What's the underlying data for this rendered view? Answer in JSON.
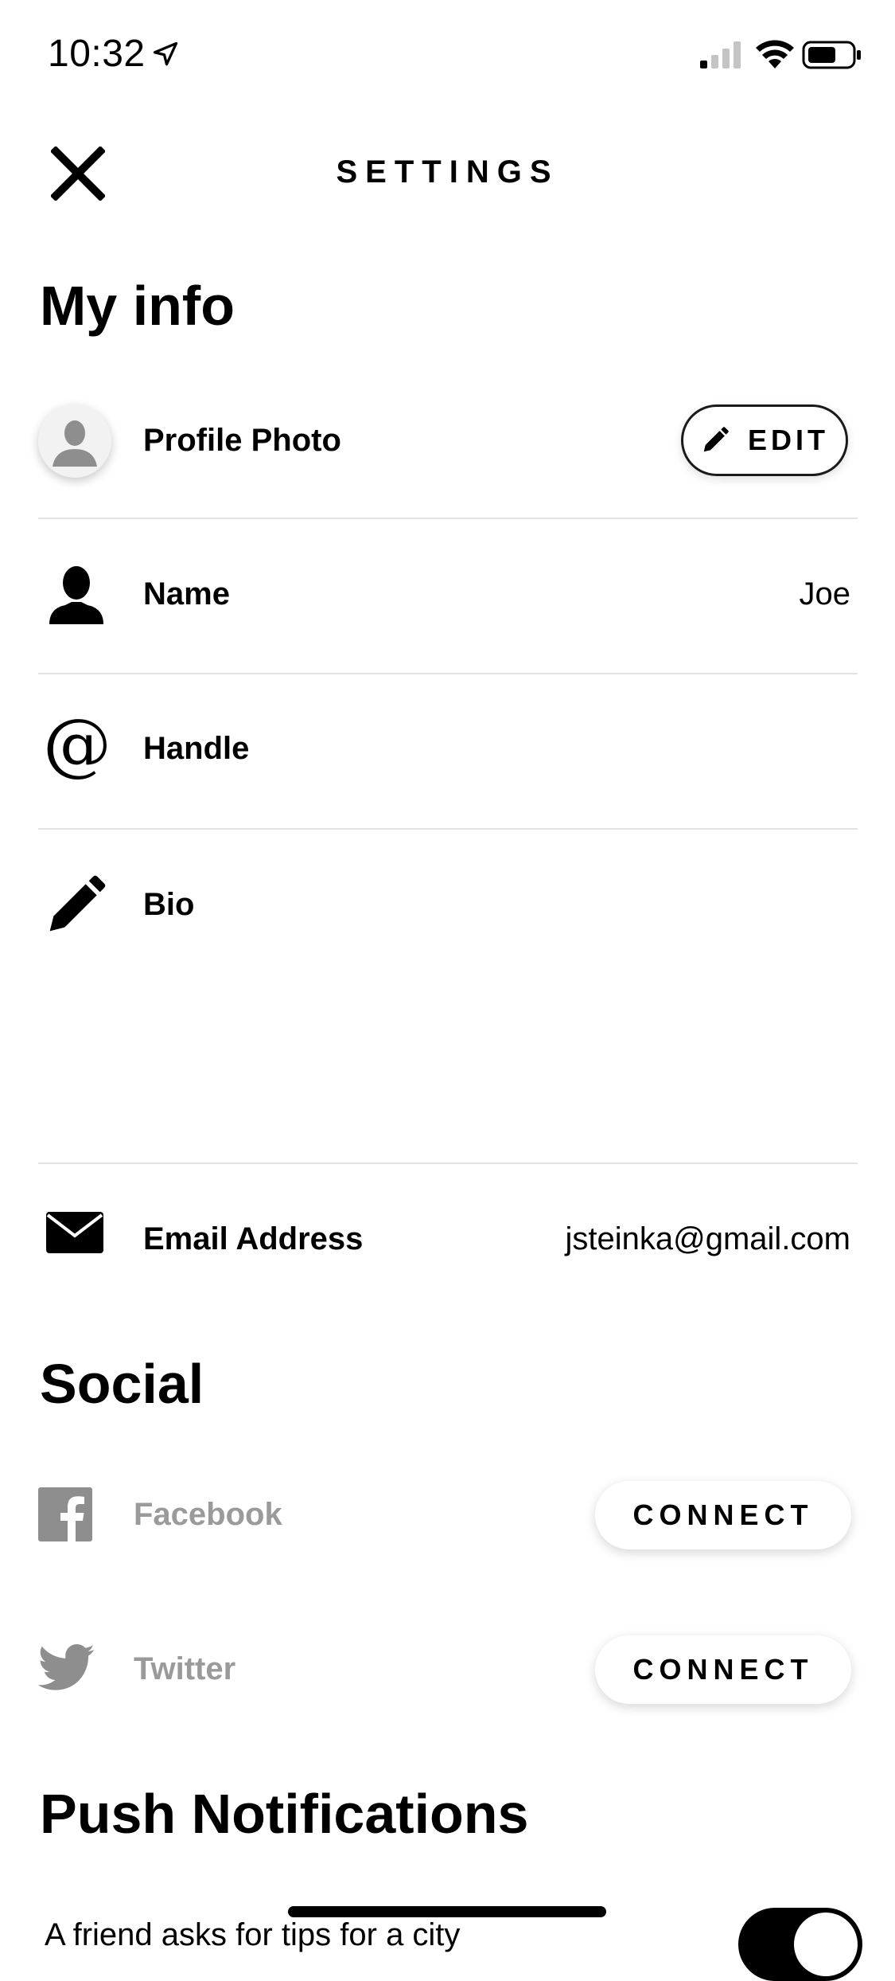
{
  "status_bar": {
    "time": "10:32"
  },
  "header": {
    "title": "SETTINGS",
    "close_icon": "close-icon"
  },
  "my_info": {
    "heading": "My info",
    "profile_photo": {
      "label": "Profile Photo",
      "edit_label": "EDIT"
    },
    "name": {
      "label": "Name",
      "value": "Joe"
    },
    "handle": {
      "label": "Handle",
      "value": ""
    },
    "bio": {
      "label": "Bio",
      "value": ""
    },
    "email": {
      "label": "Email Address",
      "value": "jsteinka@gmail.com"
    }
  },
  "social": {
    "heading": "Social",
    "items": [
      {
        "label": "Facebook",
        "button": "CONNECT",
        "icon": "facebook-icon"
      },
      {
        "label": "Twitter",
        "button": "CONNECT",
        "icon": "twitter-icon"
      }
    ]
  },
  "push_notifications": {
    "heading": "Push Notifications",
    "first_item_label": "A friend asks for tips for a city",
    "first_item_enabled": true
  },
  "colors": {
    "text": "#000000",
    "muted": "#9a9a9a",
    "divider": "#e3e3e3",
    "background": "#ffffff"
  }
}
